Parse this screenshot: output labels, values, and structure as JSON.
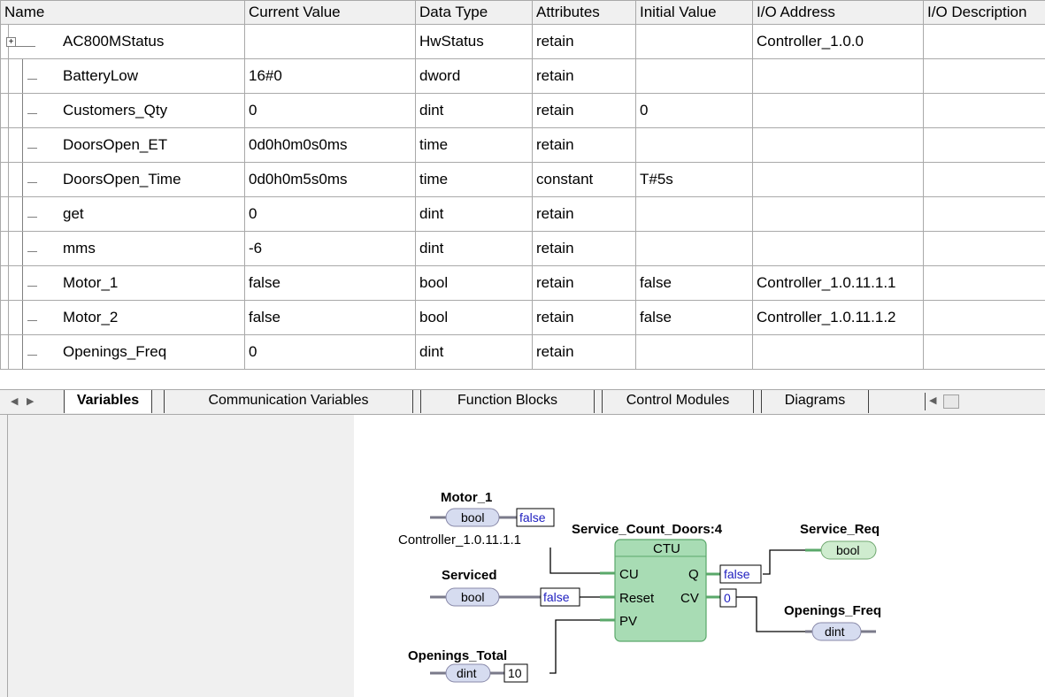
{
  "table": {
    "columns": [
      "Name",
      "Current Value",
      "Data Type",
      "Attributes",
      "Initial Value",
      "I/O Address",
      "I/O Description"
    ],
    "rows": [
      {
        "name": "AC800MStatus",
        "current": "",
        "type": "HwStatus",
        "attr": "retain",
        "initial": "",
        "io": "Controller_1.0.0",
        "desc": ""
      },
      {
        "name": "BatteryLow",
        "current": "16#0",
        "type": "dword",
        "attr": "retain",
        "initial": "",
        "io": "",
        "desc": ""
      },
      {
        "name": "Customers_Qty",
        "current": "0",
        "type": "dint",
        "attr": "retain",
        "initial": "0",
        "io": "",
        "desc": ""
      },
      {
        "name": "DoorsOpen_ET",
        "current": "0d0h0m0s0ms",
        "type": "time",
        "attr": "retain",
        "initial": "",
        "io": "",
        "desc": ""
      },
      {
        "name": "DoorsOpen_Time",
        "current": "0d0h0m5s0ms",
        "type": "time",
        "attr": "constant",
        "initial": "T#5s",
        "io": "",
        "desc": ""
      },
      {
        "name": "get",
        "current": "0",
        "type": "dint",
        "attr": "retain",
        "initial": "",
        "io": "",
        "desc": ""
      },
      {
        "name": "mms",
        "current": "-6",
        "type": "dint",
        "attr": "retain",
        "initial": "",
        "io": "",
        "desc": ""
      },
      {
        "name": "Motor_1",
        "current": "false",
        "type": "bool",
        "attr": "retain",
        "initial": "false",
        "io": "Controller_1.0.11.1.1",
        "desc": ""
      },
      {
        "name": "Motor_2",
        "current": "false",
        "type": "bool",
        "attr": "retain",
        "initial": "false",
        "io": "Controller_1.0.11.1.2",
        "desc": ""
      },
      {
        "name": "Openings_Freq",
        "current": "0",
        "type": "dint",
        "attr": "retain",
        "initial": "",
        "io": "",
        "desc": ""
      }
    ]
  },
  "tabs": [
    "Variables",
    "Communication Variables",
    "Function Blocks",
    "Control Modules",
    "Diagrams"
  ],
  "diagram": {
    "block": {
      "title": "Service_Count_Doors:4",
      "type": "CTU",
      "pins": {
        "cu": "CU",
        "reset": "Reset",
        "pv": "PV",
        "q": "Q",
        "cv": "CV"
      }
    },
    "motor1": {
      "name": "Motor_1",
      "type": "bool",
      "value": "false",
      "address": "Controller_1.0.11.1.1"
    },
    "serviced": {
      "name": "Serviced",
      "type": "bool",
      "value": "false"
    },
    "openings_total": {
      "name": "Openings_Total",
      "type": "dint",
      "value": "10"
    },
    "service_req": {
      "name": "Service_Req",
      "type": "bool",
      "value": "false"
    },
    "openings_freq": {
      "name": "Openings_Freq",
      "type": "dint",
      "value": "0"
    }
  },
  "colors": {
    "block_fill": "#a8dcb4",
    "pill_in": "#d6dcf0",
    "pill_out": "#cfeccf",
    "value_text": "#2020c0"
  }
}
